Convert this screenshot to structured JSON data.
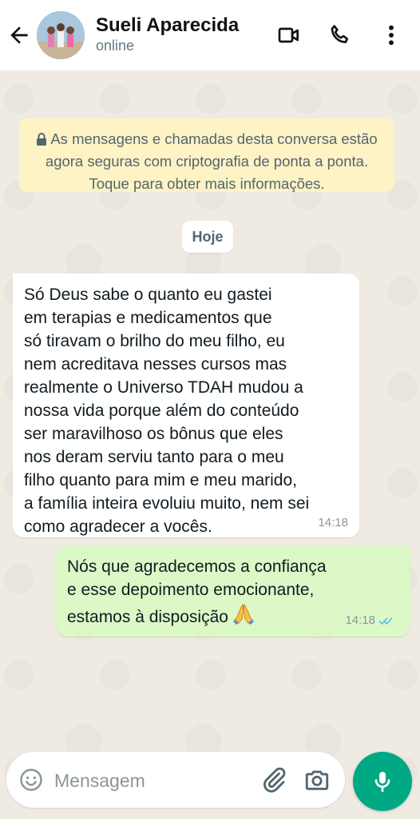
{
  "header": {
    "contact_name": "Sueli Aparecida",
    "status": "online",
    "icons": [
      "back-arrow-icon",
      "video-call-icon",
      "voice-call-icon",
      "more-options-icon"
    ]
  },
  "chat": {
    "encryption_notice": "As mensagens e chamadas desta conversa estão agora seguras com criptografia de ponta a ponta. Toque para obter mais informações.",
    "date_chip": "Hoje",
    "messages": [
      {
        "direction": "incoming",
        "text": "Só Deus sabe o quanto eu gastei\nem terapias e medicamentos que\nsó tiravam o brilho do meu filho, eu\nnem acreditava nesses cursos mas\nrealmente o Universo TDAH mudou a\nnossa vida porque além do conteúdo\nser maravilhoso os bônus que eles\nnos deram serviu tanto para o meu\nfilho quanto para mim e meu marido,\na família inteira evoluiu muito, nem sei\ncomo agradecer a vocês.",
        "time": "14:18"
      },
      {
        "direction": "outgoing",
        "text": "Nós que agradecemos a confiança\ne esse depoimento emocionante,\nestamos à disposição",
        "emoji": "praying-hands",
        "time": "14:18",
        "read": true
      }
    ]
  },
  "composer": {
    "placeholder": "Mensagem"
  },
  "colors": {
    "accent": "#00a884",
    "outgoing_bubble": "#dcf8c6",
    "incoming_bubble": "#ffffff",
    "notice_bg": "#fdf3c5",
    "read_ticks": "#53bdeb"
  }
}
